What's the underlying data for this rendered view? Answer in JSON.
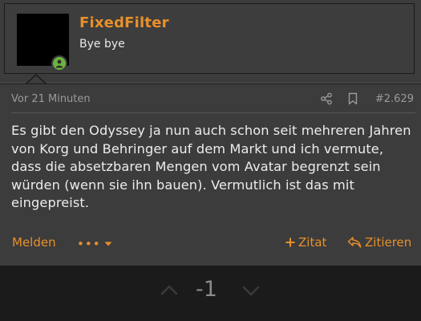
{
  "user": {
    "name": "FixedFilter",
    "title": "Bye bye",
    "status_color": "#6cb33f"
  },
  "post": {
    "time": "Vor 21 Minuten",
    "number": "#2.629",
    "message": "Es gibt den Odyssey ja nun auch schon seit mehreren Jahren von Korg und Behringer auf dem Markt und ich vermute, dass die absetzbaren Mengen vom Avatar begrenzt sein würden (wenn sie ihn bauen). Vermutlich ist das mit eingepreist.",
    "icons": [
      "share-icon",
      "bookmark-icon"
    ]
  },
  "actions": {
    "report": "Melden",
    "more": "•••",
    "quote": "Zitat",
    "reply": "Zitieren"
  },
  "vote": {
    "score": "-1"
  },
  "colors": {
    "accent": "#e8902b",
    "panel": "#3c3c3c",
    "background": "#1b1b1b"
  }
}
